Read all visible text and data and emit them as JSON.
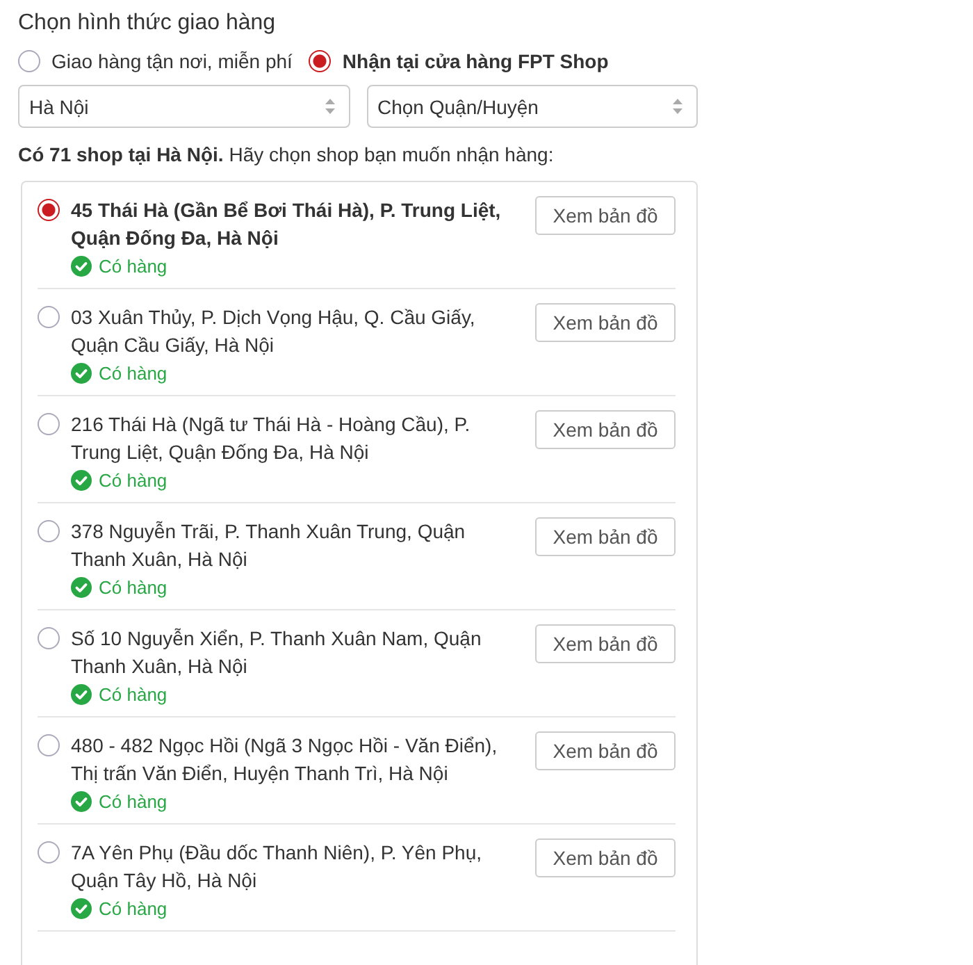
{
  "title": "Chọn hình thức giao hàng",
  "delivery_options": [
    {
      "label": "Giao hàng tận nơi, miễn phí",
      "selected": false
    },
    {
      "label": "Nhận tại cửa hàng FPT Shop",
      "selected": true
    }
  ],
  "selects": [
    {
      "value": "Hà Nội"
    },
    {
      "value": "Chọn Quận/Huyện"
    }
  ],
  "summary": "**Có 71 shop tại Hà Nội.** Hãy chọn shop bạn muốn nhận hàng:",
  "shops": [
    {
      "address": "45 Thái Hà (Gần Bể Bơi Thái Hà), P. Trung Liệt, Quận Đống Đa, Hà Nội",
      "selected": true,
      "in_stock": true,
      "status": "Có hàng",
      "button": "Xem bản đồ"
    },
    {
      "address": "03 Xuân Thủy, P. Dịch Vọng Hậu, Q. Cầu Giấy, Quận Cầu Giấy, Hà Nội",
      "selected": false,
      "in_stock": true,
      "status": "Có hàng",
      "button": "Xem bản đồ"
    },
    {
      "address": "216 Thái Hà (Ngã tư Thái Hà - Hoàng Cầu), P. Trung Liệt, Quận Đống Đa, Hà Nội",
      "selected": false,
      "in_stock": true,
      "status": "Có hàng",
      "button": "Xem bản đồ"
    },
    {
      "address": "378 Nguyễn Trãi, P. Thanh Xuân Trung, Quận Thanh Xuân, Hà Nội",
      "selected": false,
      "in_stock": true,
      "status": "Có hàng",
      "button": "Xem bản đồ"
    },
    {
      "address": "Số 10 Nguyễn Xiển, P. Thanh Xuân Nam, Quận Thanh Xuân, Hà Nội",
      "selected": false,
      "in_stock": true,
      "status": "Có hàng",
      "button": "Xem bản đồ"
    },
    {
      "address": "480 - 482 Ngọc Hồi (Ngã 3 Ngọc Hồi - Văn Điển), Thị trấn Văn Điển, Huyện Thanh Trì, Hà Nội",
      "selected": false,
      "in_stock": true,
      "status": "Có hàng",
      "button": "Xem bản đồ"
    },
    {
      "address": "7A Yên Phụ (Đầu dốc Thanh Niên), P. Yên Phụ, Quận Tây Hồ, Hà Nội",
      "selected": false,
      "in_stock": true,
      "status": "Có hàng",
      "button": "Xem bản đồ"
    }
  ]
}
